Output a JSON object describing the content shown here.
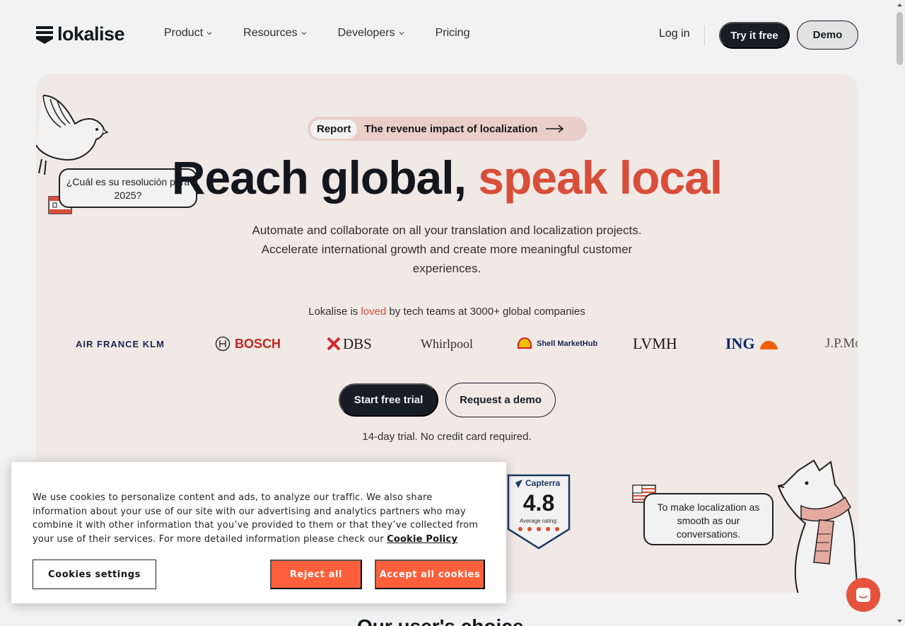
{
  "header": {
    "logo_text": "lokalise",
    "nav": [
      {
        "label": "Product",
        "has_dropdown": true
      },
      {
        "label": "Resources",
        "has_dropdown": true
      },
      {
        "label": "Developers",
        "has_dropdown": true
      },
      {
        "label": "Pricing",
        "has_dropdown": false
      }
    ],
    "login": "Log in",
    "try_free": "Try it free",
    "demo": "Demo"
  },
  "hero": {
    "pill_tag": "Report",
    "pill_text": "The revenue impact of localization",
    "headline_main": "Reach global,",
    "headline_accent": "speak local",
    "subtitle": "Automate and collaborate on all your translation and localization projects. Accelerate international growth and create more meaningful customer experiences.",
    "loved_before": "Lokalise is ",
    "loved_accent": "loved",
    "loved_after": " by tech teams at 3000+ global companies",
    "brands": [
      "AIR FRANCE KLM",
      "BOSCH",
      "DBS",
      "Whirlpool",
      "Shell MarketHub",
      "LVMH",
      "ING",
      "J.P.Mo"
    ],
    "cta_primary": "Start free trial",
    "cta_secondary": "Request a demo",
    "trial_note": "14-day trial. No credit card required.",
    "bubble_es": "¿Cuál es su resolución para 2025?",
    "bubble_en": "To make localization as smooth as our conversations."
  },
  "capterra": {
    "name": "Capterra",
    "score": "4.8",
    "label": "Average rating:",
    "stars": 5
  },
  "cookie": {
    "text": "We use cookies to personalize content and ads, to analyze our traffic. We also share information about your use of our site with our advertising and analytics partners who may combine it with other information that you’ve provided to them or that they’ve collected from your use of their services. For more detailed information please check our ",
    "policy_link": "Cookie Policy",
    "settings": "Cookies settings",
    "reject": "Reject all",
    "accept": "Accept all cookies"
  },
  "below_fold": "Our user's choice",
  "colors": {
    "accent": "#e5533d",
    "dark": "#1a1f27",
    "hero_bg": "#fdf6f3",
    "cookie_button": "#ff5f3a"
  }
}
